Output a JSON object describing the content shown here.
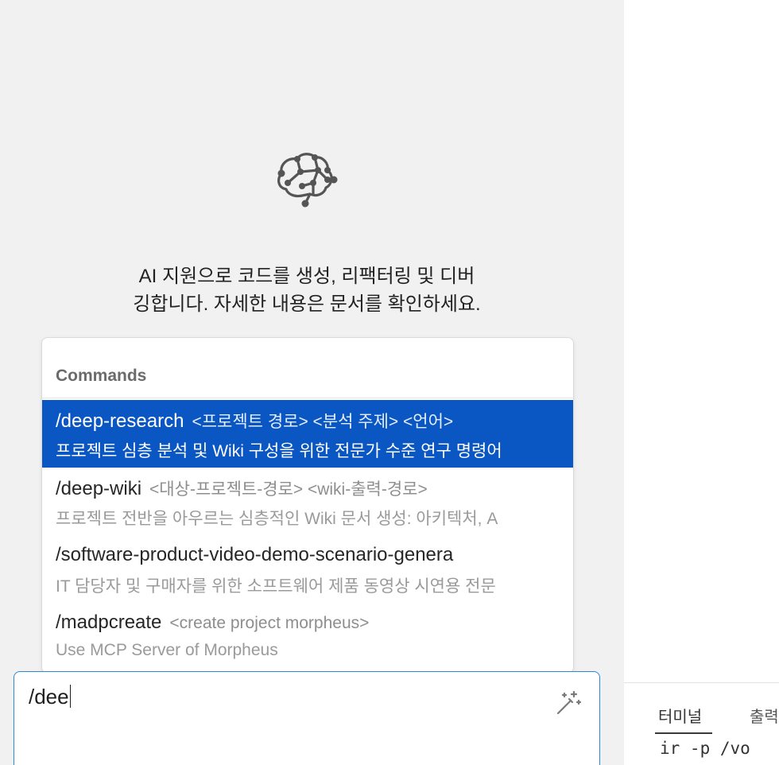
{
  "welcome": {
    "line1": "AI 지원으로 코드를 생성, 리팩터링 및 디버",
    "line2": "깅합니다. 자세한 내용은 문서를 확인하세요."
  },
  "commands": {
    "header": "Commands",
    "items": [
      {
        "name": "/deep-research",
        "args": "<프로젝트 경로> <분석 주제> <언어>",
        "desc": "프로젝트 심층 분석 및 Wiki 구성을 위한 전문가 수준 연구 명령어",
        "selected": true
      },
      {
        "name": "/deep-wiki",
        "args": "<대상-프로젝트-경로> <wiki-출력-경로>",
        "desc": "프로젝트 전반을 아우르는 심층적인 Wiki 문서 생성: 아키텍처, A",
        "selected": false
      },
      {
        "name": "/software-product-video-demo-scenario-genera",
        "args": "",
        "desc": "IT 담당자 및 구매자를 위한 소프트웨어 제품 동영상 시연용 전문",
        "selected": false
      },
      {
        "name": "/madpcreate",
        "args": "<create project morpheus>",
        "desc": "Use MCP Server of Morpheus",
        "selected": false
      }
    ]
  },
  "input": {
    "value": "/dee"
  },
  "bottom_panel": {
    "tab_terminal": "터미널",
    "tab_output": "출력",
    "terminal_line": "ir -p /vo"
  },
  "colors": {
    "selection": "#0a56c2",
    "input_border": "#2f86d8",
    "panel_bg": "#f1f1f1"
  },
  "icons": {
    "logo": "brain-network-icon",
    "input_action": "magic-wand-icon"
  }
}
